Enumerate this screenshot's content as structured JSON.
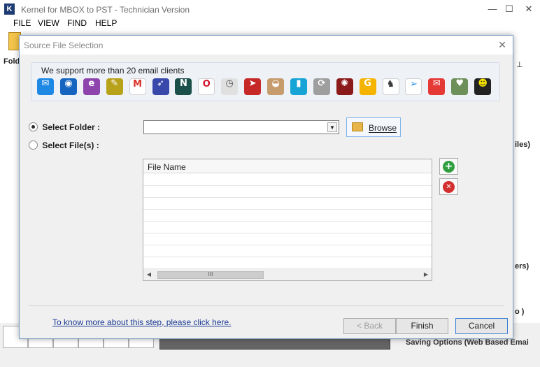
{
  "window": {
    "title": "Kernel for MBOX to PST - Technician Version",
    "logo_letter": "K",
    "controls": {
      "minimize": "—",
      "maximize": "☐",
      "close": "✕"
    }
  },
  "menu": [
    "FILE",
    "VIEW",
    "FIND",
    "HELP"
  ],
  "background": {
    "folder_label": "Fold",
    "right_fragments": [
      "iles)",
      "ers)",
      "o )"
    ],
    "bottom_right_text": "Saving Options (Web Based Emai"
  },
  "dialog": {
    "title": "Source File Selection",
    "close_glyph": "✕",
    "clients": {
      "caption": "We support more than 20 email clients",
      "icons": [
        {
          "name": "mail-app-icon",
          "color": "#1e88e5",
          "glyph": "✉"
        },
        {
          "name": "thunderbird-icon",
          "color": "#1565c0",
          "glyph": "◉"
        },
        {
          "name": "eudora-icon",
          "color": "#8e44ad",
          "glyph": "e"
        },
        {
          "name": "entourage-icon",
          "color": "#b8a21a",
          "glyph": "✎"
        },
        {
          "name": "gmail-icon",
          "color": "#ffffff",
          "glyph": "M",
          "fg": "#d93025"
        },
        {
          "name": "postbox-icon",
          "color": "#3949ab",
          "glyph": "➶"
        },
        {
          "name": "netscape-icon",
          "color": "#1b4f4a",
          "glyph": "N"
        },
        {
          "name": "opera-icon",
          "color": "#ffffff",
          "glyph": "O",
          "fg": "#d3142a"
        },
        {
          "name": "spicebird-icon",
          "color": "#e0e0e0",
          "glyph": "◷",
          "fg": "#555555"
        },
        {
          "name": "powermail-icon",
          "color": "#c62828",
          "glyph": "➤"
        },
        {
          "name": "seamonkey-icon",
          "color": "#c69c6d",
          "glyph": "◒"
        },
        {
          "name": "claws-mail-icon",
          "color": "#16a3d6",
          "glyph": "▮"
        },
        {
          "name": "sylpheed-icon",
          "color": "#9e9e9e",
          "glyph": "⟳"
        },
        {
          "name": "cocoa-icon",
          "color": "#8b1a1a",
          "glyph": "✺"
        },
        {
          "name": "gyazmail-icon",
          "color": "#f4b400",
          "glyph": "G"
        },
        {
          "name": "mutt-icon",
          "color": "#ffffff",
          "glyph": "♞",
          "fg": "#333333"
        },
        {
          "name": "mulberry-icon",
          "color": "#ffffff",
          "glyph": "➢",
          "fg": "#1e88e5"
        },
        {
          "name": "mailcopa-icon",
          "color": "#e53935",
          "glyph": "✉"
        },
        {
          "name": "evolution-icon",
          "color": "#6d8f5a",
          "glyph": "♥"
        },
        {
          "name": "the-bat-icon",
          "color": "#222222",
          "glyph": "☻",
          "fg": "#f5e000"
        }
      ]
    },
    "select_folder_label": "Select Folder :",
    "select_files_label": "Select File(s) :",
    "folder_value": "",
    "browse_label": "Browse",
    "grid": {
      "column": "File Name",
      "rows": [
        "",
        "",
        "",
        "",
        "",
        "",
        "",
        ""
      ],
      "scroll_thumb": "III",
      "scroll_left": "◀",
      "scroll_right": "▶"
    },
    "add_glyph": "+",
    "remove_glyph": "✕",
    "help_link": "To know more about this step, please click here.",
    "buttons": {
      "back": "< Back",
      "finish": "Finish",
      "cancel": "Cancel"
    }
  }
}
